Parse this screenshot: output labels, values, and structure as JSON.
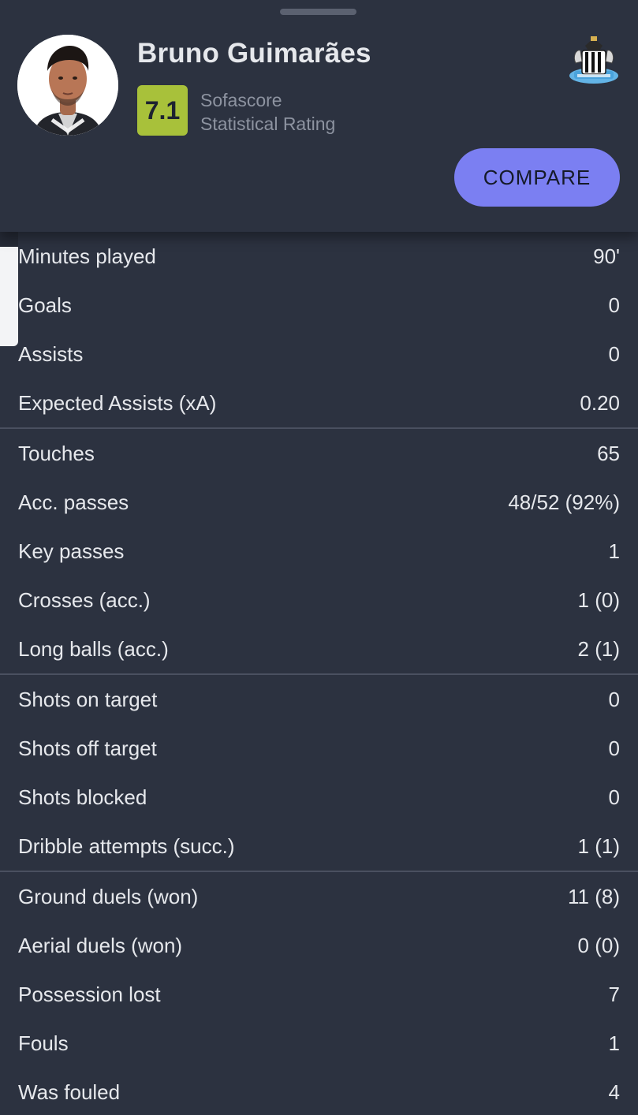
{
  "player": {
    "name": "Bruno Guimarães",
    "rating": "7.1",
    "rating_label_line1": "Sofascore",
    "rating_label_line2": "Statistical Rating",
    "avatar_icon": "player-photo",
    "club_icon": "newcastle-crest-icon"
  },
  "actions": {
    "compare_label": "COMPARE"
  },
  "colors": {
    "background": "#2c3240",
    "rating_badge": "#a8c13a",
    "compare_button": "#7b7ff2",
    "divider": "#4a5060"
  },
  "stat_groups": [
    {
      "rows": [
        {
          "label": "Minutes played",
          "value": "90'"
        },
        {
          "label": "Goals",
          "value": "0"
        },
        {
          "label": "Assists",
          "value": "0"
        },
        {
          "label": "Expected Assists (xA)",
          "value": "0.20"
        }
      ]
    },
    {
      "rows": [
        {
          "label": "Touches",
          "value": "65"
        },
        {
          "label": "Acc. passes",
          "value": "48/52 (92%)"
        },
        {
          "label": "Key passes",
          "value": "1"
        },
        {
          "label": "Crosses (acc.)",
          "value": "1 (0)"
        },
        {
          "label": "Long balls (acc.)",
          "value": "2 (1)"
        }
      ]
    },
    {
      "rows": [
        {
          "label": "Shots on target",
          "value": "0"
        },
        {
          "label": "Shots off target",
          "value": "0"
        },
        {
          "label": "Shots blocked",
          "value": "0"
        },
        {
          "label": "Dribble attempts (succ.)",
          "value": "1 (1)"
        }
      ]
    },
    {
      "rows": [
        {
          "label": "Ground duels (won)",
          "value": "11 (8)"
        },
        {
          "label": "Aerial duels (won)",
          "value": "0 (0)"
        },
        {
          "label": "Possession lost",
          "value": "7"
        },
        {
          "label": "Fouls",
          "value": "1"
        },
        {
          "label": "Was fouled",
          "value": "4"
        }
      ]
    }
  ]
}
